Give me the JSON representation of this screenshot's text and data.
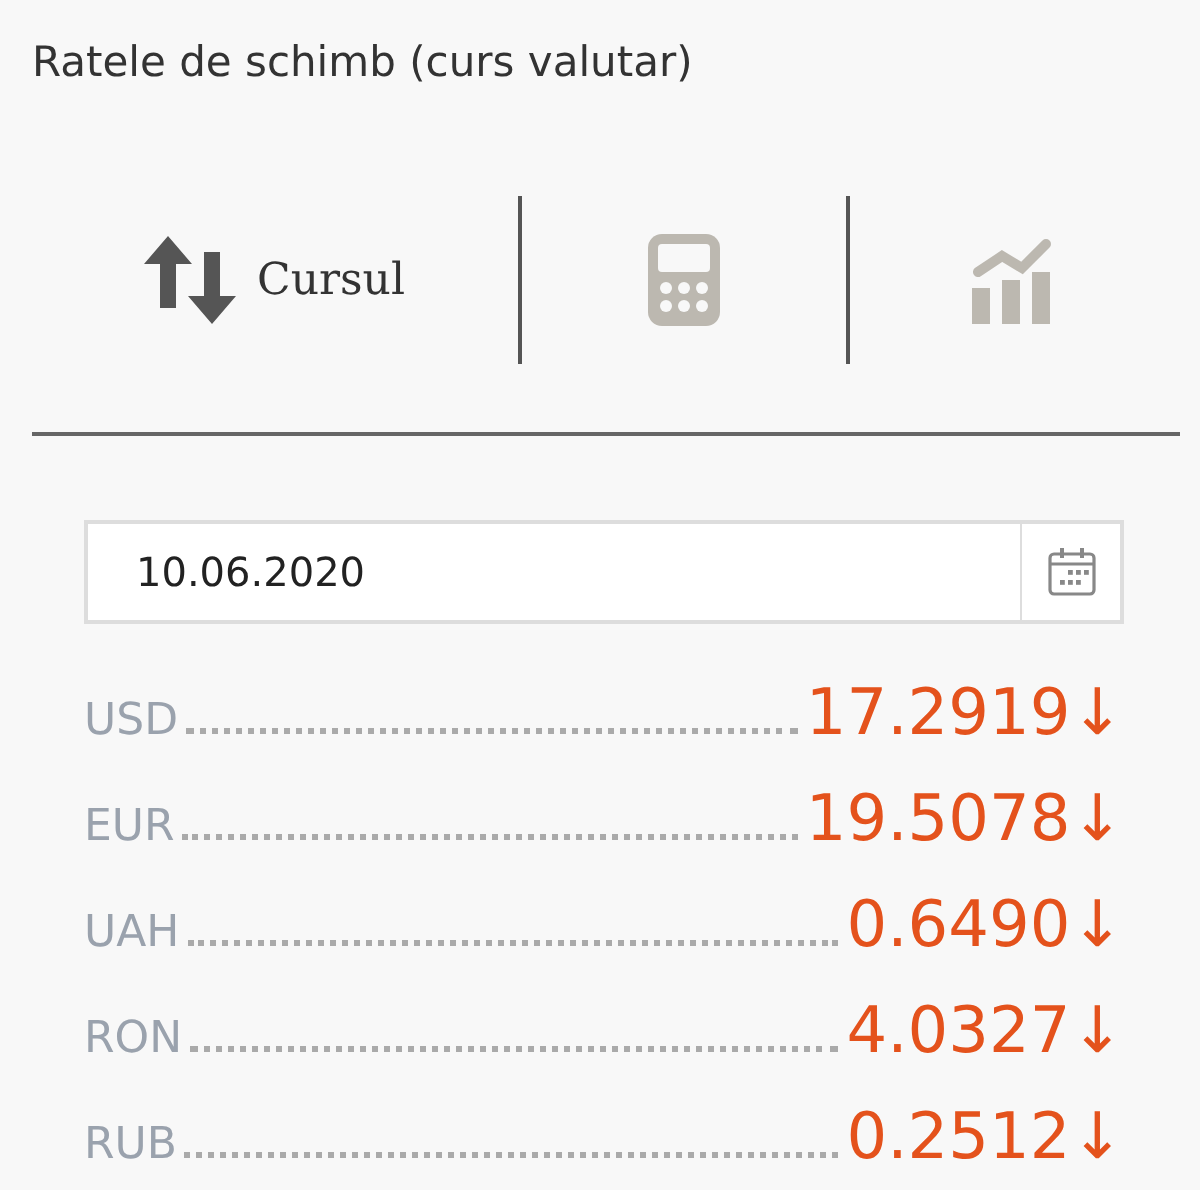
{
  "title": "Ratele de schimb (curs valutar)",
  "tabs": [
    {
      "kind": "exchange",
      "label": "Cursul",
      "selected": true
    },
    {
      "kind": "calculator",
      "selected": false
    },
    {
      "kind": "chart",
      "selected": false
    }
  ],
  "date_field": {
    "value": "10.06.2020"
  },
  "rates": [
    {
      "currency": "USD",
      "value": "17.2919",
      "trend": "↓"
    },
    {
      "currency": "EUR",
      "value": "19.5078",
      "trend": "↓"
    },
    {
      "currency": "UAH",
      "value": "0.6490",
      "trend": "↓"
    },
    {
      "currency": "RON",
      "value": "4.0327",
      "trend": "↓"
    },
    {
      "currency": "RUB",
      "value": "0.2512",
      "trend": "↓"
    }
  ]
}
